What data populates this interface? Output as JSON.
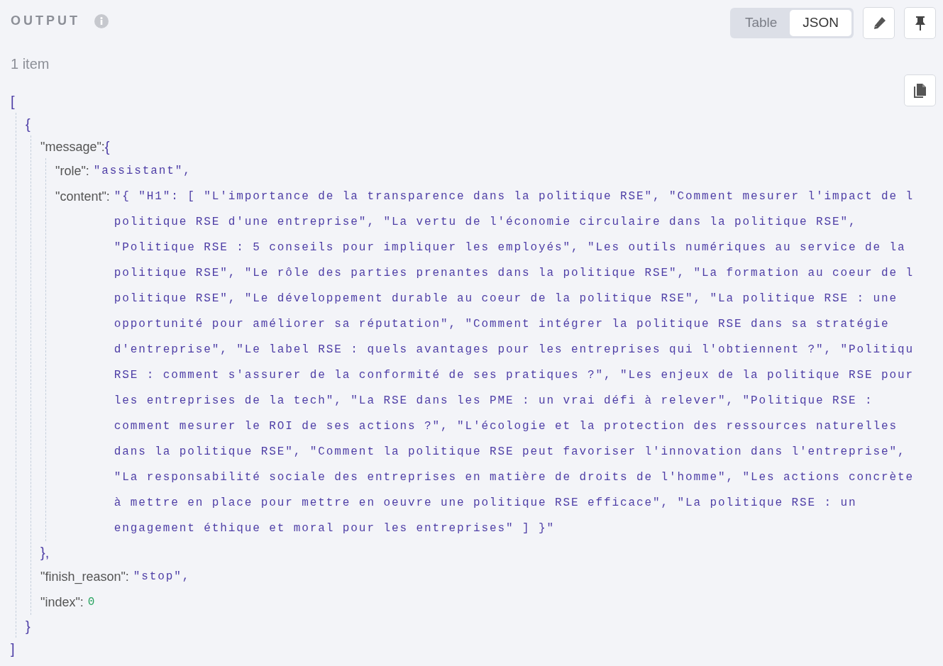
{
  "header": {
    "title": "OUTPUT",
    "count": "1 item"
  },
  "view_tabs": [
    {
      "label": "Table",
      "selected": false
    },
    {
      "label": "JSON",
      "selected": true
    }
  ],
  "json_view": {
    "open": "[",
    "close": "]",
    "children": [
      {
        "open": "{",
        "close": "}",
        "children": [
          {
            "key": "\"message\":",
            "open": "{",
            "close": "},",
            "children": [
              {
                "key": "\"role\":",
                "kind": "string",
                "value_lines": [
                  "\"assistant\","
                ]
              },
              {
                "key": "\"content\":",
                "kind": "string",
                "value_lines": [
                  "\"{ \"H1\": [ \"L'importance de la transparence dans la politique RSE\", \"Comment mesurer l'impact de l",
                  "politique RSE d'une entreprise\", \"La vertu de l'économie circulaire dans la politique RSE\",",
                  "\"Politique RSE : 5 conseils pour impliquer les employés\", \"Les outils numériques au service de la",
                  "politique RSE\", \"Le rôle des parties prenantes dans la politique RSE\", \"La formation au coeur de l",
                  "politique RSE\", \"Le développement durable au coeur de la politique RSE\", \"La politique RSE : une",
                  "opportunité pour améliorer sa réputation\", \"Comment intégrer la politique RSE dans sa stratégie",
                  "d'entreprise\", \"Le label RSE : quels avantages pour les entreprises qui l'obtiennent ?\", \"Politiqu",
                  "RSE : comment s'assurer de la conformité de ses pratiques ?\", \"Les enjeux de la politique RSE pour",
                  "les entreprises de la tech\", \"La RSE dans les PME : un vrai défi à relever\", \"Politique RSE :",
                  "comment mesurer le ROI de ses actions ?\", \"L'écologie et la protection des ressources naturelles",
                  "dans la politique RSE\", \"Comment la politique RSE peut favoriser l'innovation dans l'entreprise\",",
                  "\"La responsabilité sociale des entreprises en matière de droits de l'homme\", \"Les actions concrète",
                  "à mettre en place pour mettre en oeuvre une politique RSE efficace\", \"La politique RSE : un",
                  "engagement éthique et moral pour les entreprises\" ] }\""
                ]
              }
            ]
          },
          {
            "key": "\"finish_reason\":",
            "kind": "string",
            "value_lines": [
              "\"stop\","
            ]
          },
          {
            "key": "\"index\":",
            "kind": "number",
            "value_lines": [
              "0"
            ]
          }
        ]
      }
    ]
  }
}
